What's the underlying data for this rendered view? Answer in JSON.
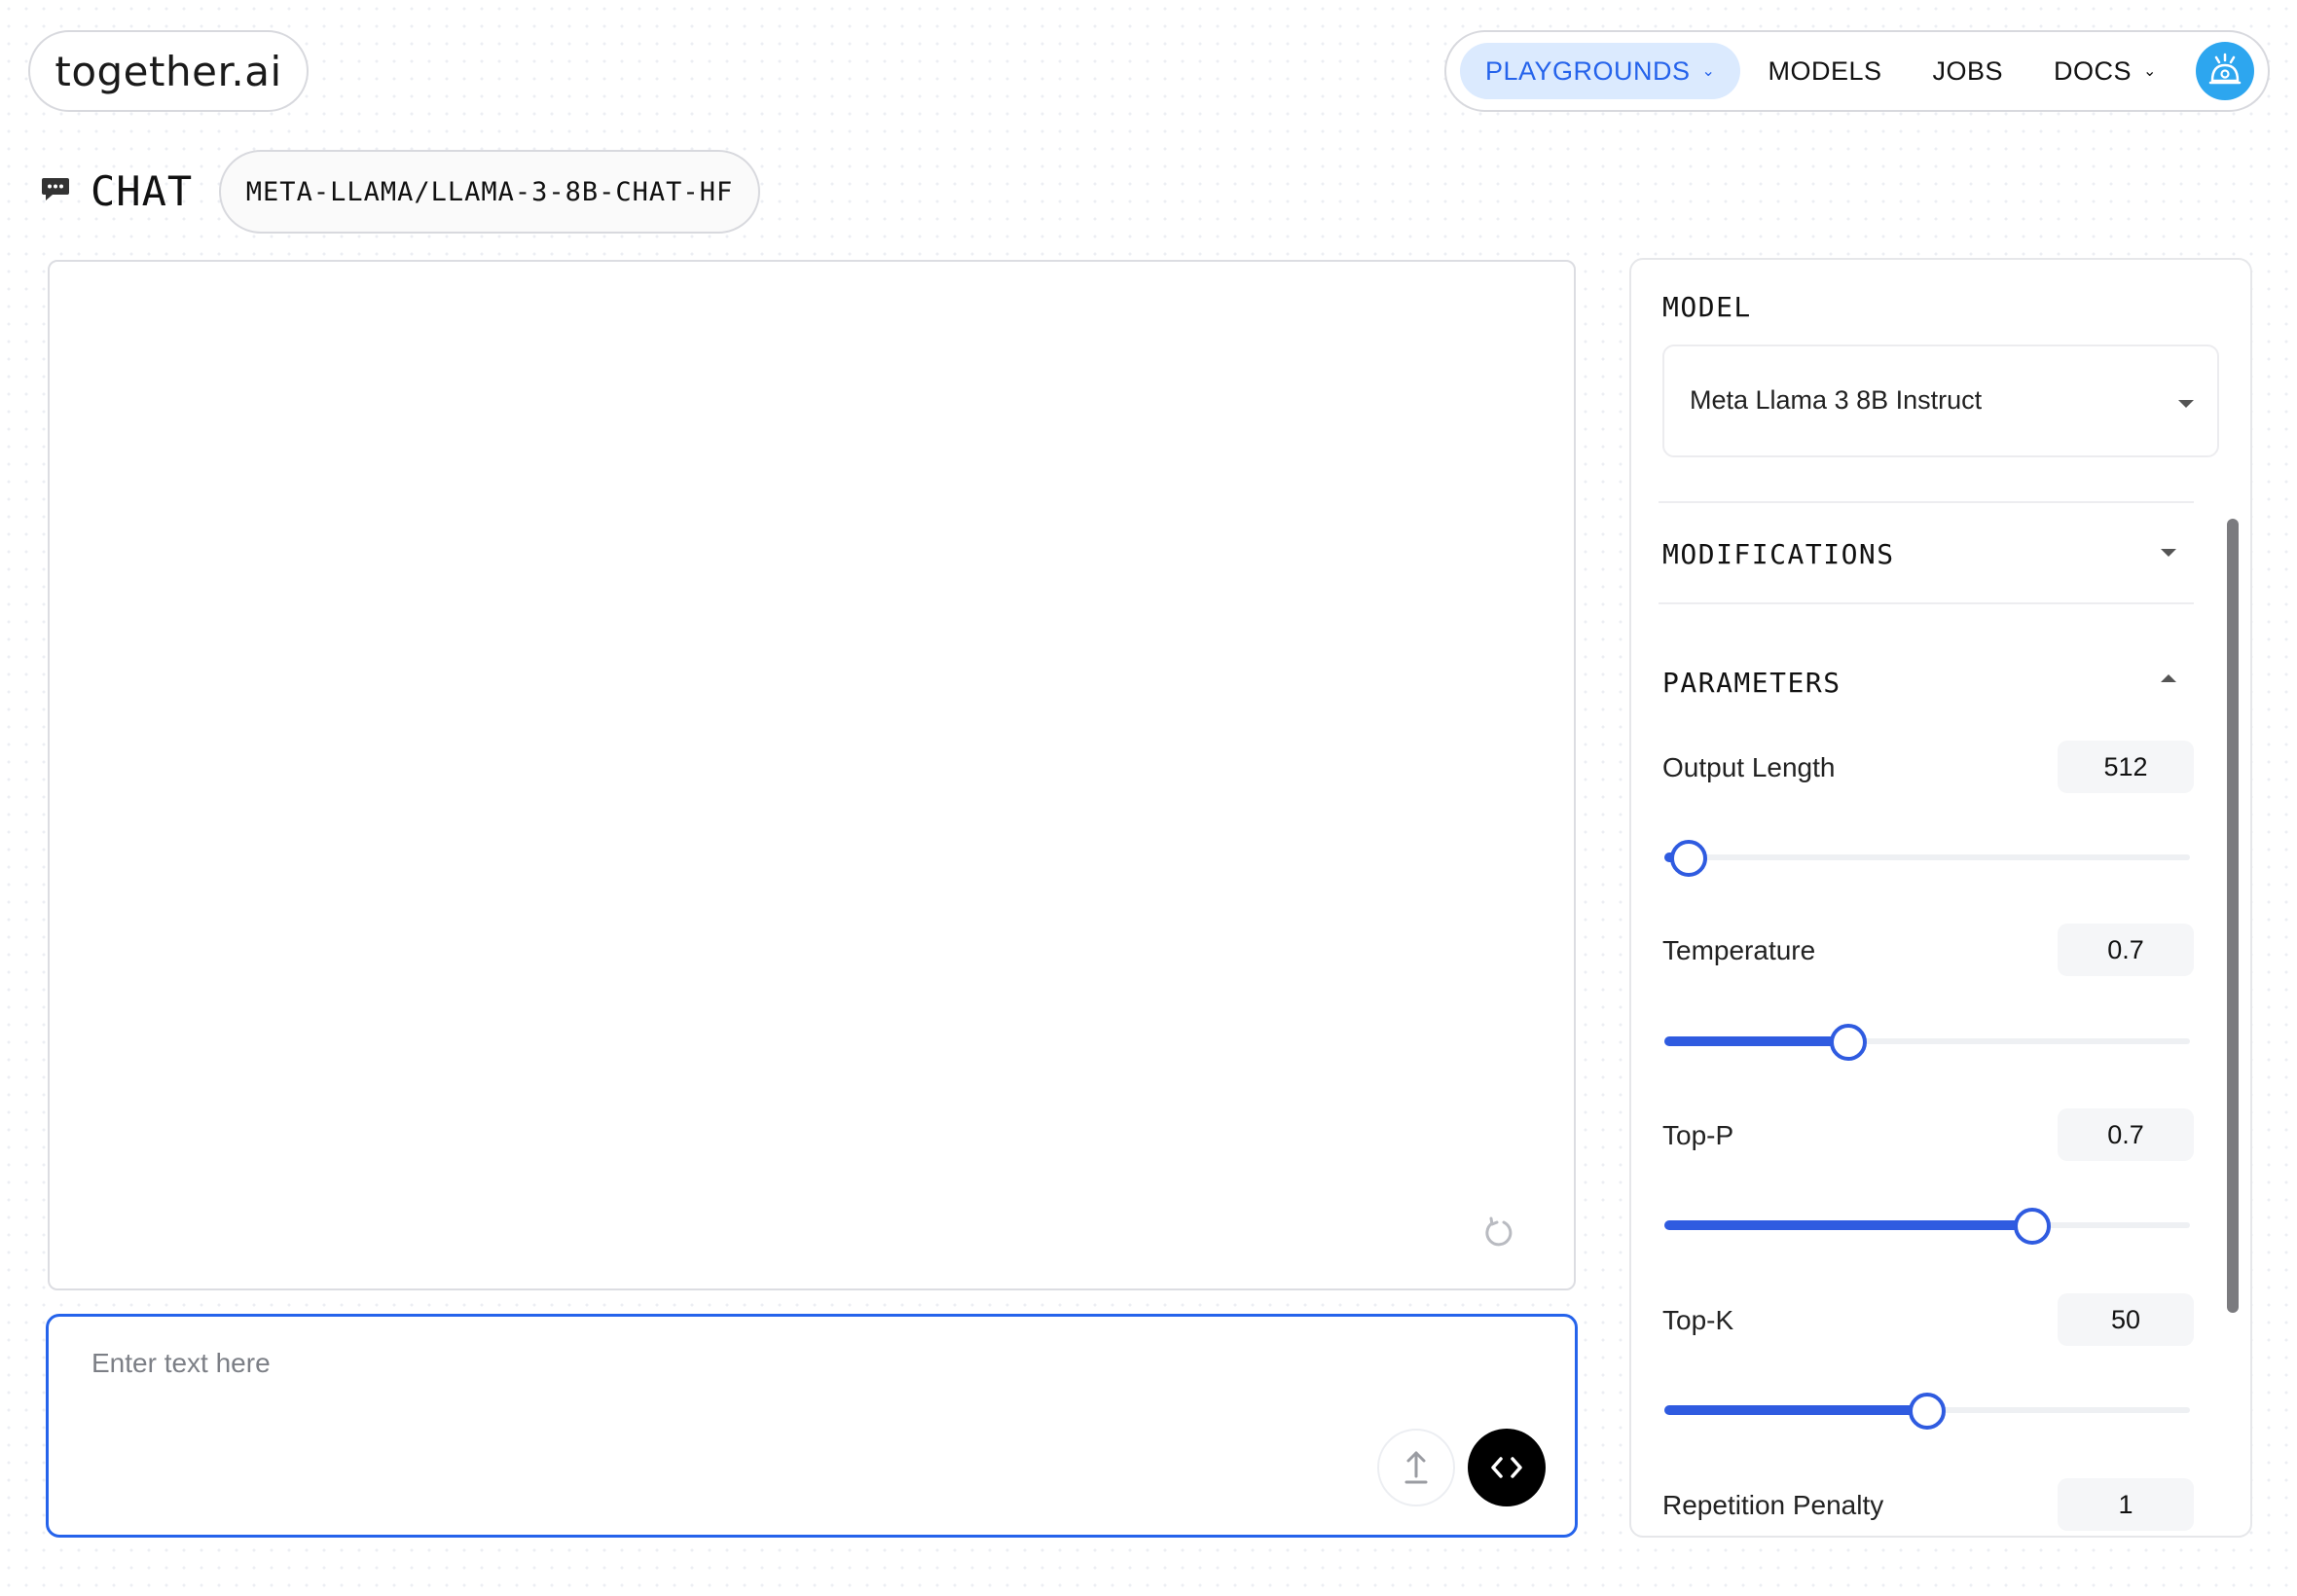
{
  "app": {
    "logo_text": "together.ai"
  },
  "nav": {
    "items": [
      {
        "label": "PLAYGROUNDS",
        "active": true,
        "has_dropdown": true
      },
      {
        "label": "MODELS",
        "active": false,
        "has_dropdown": false
      },
      {
        "label": "JOBS",
        "active": false,
        "has_dropdown": false
      },
      {
        "label": "DOCS",
        "active": false,
        "has_dropdown": true
      }
    ],
    "avatar_icon": "robot-icon",
    "accent_color": "#2563eb",
    "active_bg": "#dbeafe"
  },
  "chat": {
    "title": "CHAT",
    "model_id": "META-LLAMA/LLAMA-3-8B-CHAT-HF",
    "input_placeholder": "Enter text here"
  },
  "settings": {
    "model_label": "MODEL",
    "model_value": "Meta Llama 3 8B Instruct",
    "modifications_label": "MODIFICATIONS",
    "parameters_label": "PARAMETERS",
    "parameters": [
      {
        "label": "Output Length",
        "value": "512",
        "fill_fraction": 0.046
      },
      {
        "label": "Temperature",
        "value": "0.7",
        "fill_fraction": 0.35
      },
      {
        "label": "Top-P",
        "value": "0.7",
        "fill_fraction": 0.7
      },
      {
        "label": "Top-K",
        "value": "50",
        "fill_fraction": 0.5
      },
      {
        "label": "Repetition Penalty",
        "value": "1",
        "fill_fraction": null
      }
    ]
  }
}
